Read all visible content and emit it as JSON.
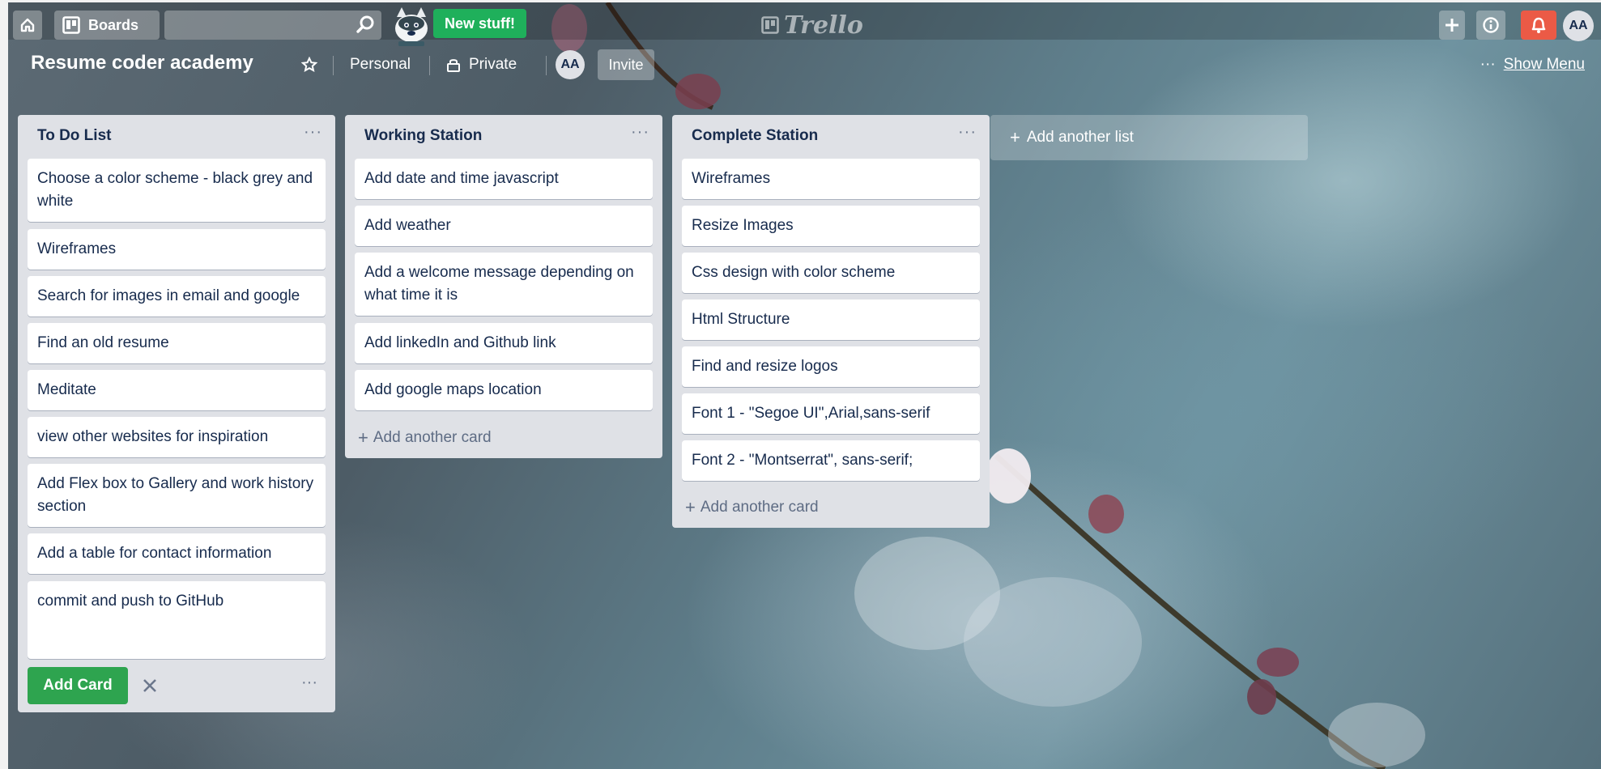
{
  "topbar": {
    "boards_label": "Boards",
    "search_placeholder": "",
    "new_stuff_label": "New stuff!",
    "logo_text": "Trello",
    "user_initials": "AA"
  },
  "board": {
    "title": "Resume coder academy",
    "team": "Personal",
    "visibility": "Private",
    "member_initials": "AA",
    "invite_label": "Invite",
    "show_menu_label": "Show Menu"
  },
  "lists": [
    {
      "title": "To Do List",
      "cards": [
        "Choose a color scheme - black grey and white",
        "Wireframes",
        "Search for images in email and google",
        "Find an old resume",
        "Meditate",
        "view other websites for inspiration",
        "Add Flex box to Gallery and work history section",
        "Add a table for contact information"
      ],
      "composer_text": "commit and push to GitHub",
      "add_button_label": "Add Card"
    },
    {
      "title": "Working Station",
      "cards": [
        "Add date and time javascript",
        "Add weather",
        "Add a welcome message depending on what time it is",
        "Add linkedIn and Github link",
        "Add google maps location"
      ],
      "add_card_label": "Add another card"
    },
    {
      "title": "Complete Station",
      "cards": [
        "Wireframes",
        "Resize Images",
        "Css design with color scheme",
        "Html Structure",
        "Find and resize logos",
        "Font 1 - \"Segoe UI\",Arial,sans-serif",
        "Font 2 - \"Montserrat\", sans-serif;"
      ],
      "add_card_label": "Add another card"
    }
  ],
  "add_list_label": "Add another list",
  "colors": {
    "green": "#2ea44f",
    "notification_red": "#eb5a46",
    "list_bg": "#dfe1e6"
  }
}
